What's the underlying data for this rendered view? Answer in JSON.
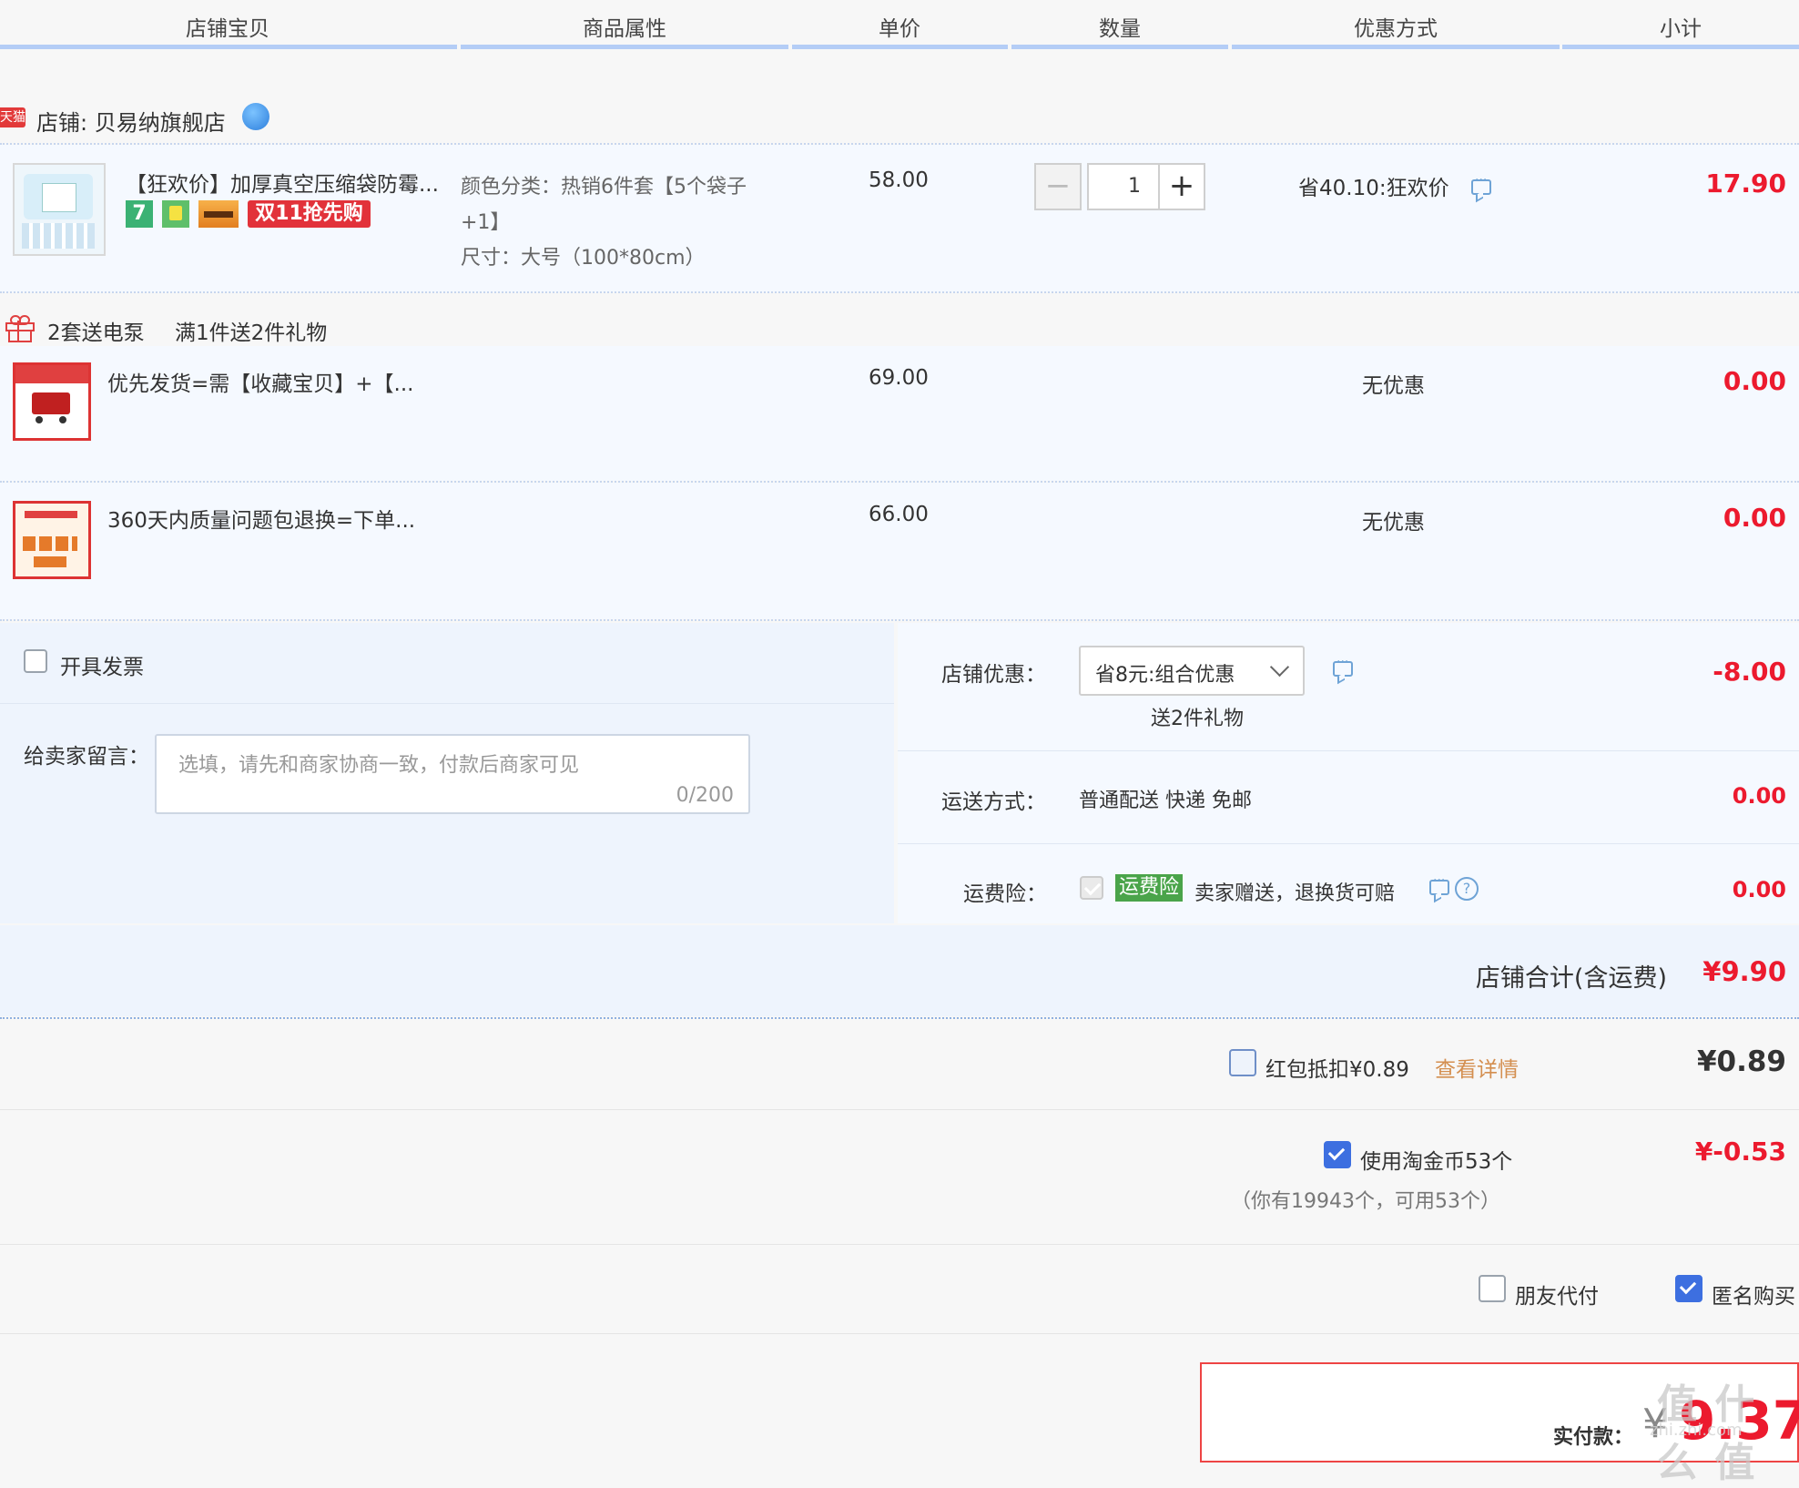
{
  "table_header": {
    "columns": [
      "店铺宝贝",
      "商品属性",
      "单价",
      "数量",
      "优惠方式",
      "小计"
    ]
  },
  "shop": {
    "badge": "天猫",
    "name": "店铺: 贝易纳旗舰店",
    "wangwang_icon": "chat-bubble-icon"
  },
  "main_item": {
    "title": "【狂欢价】加厚真空压缩袋防霉...",
    "badges": [
      "7",
      "保",
      "card",
      "双11抢先购"
    ],
    "attr_color": "颜色分类：热销6件套【5个袋子",
    "attr_color_cont": "+1】",
    "attr_size": "尺寸：大号（100*80cm）",
    "unit_price": "58.00",
    "quantity": "1",
    "discount": "省40.10:狂欢价",
    "subtotal": "17.90"
  },
  "gift_promo": {
    "label1": "2套送电泵",
    "label2": "满1件送2件礼物"
  },
  "gift_items": [
    {
      "title": "优先发货=需【收藏宝贝】+【...",
      "price": "69.00",
      "discount": "无优惠",
      "subtotal": "0.00"
    },
    {
      "title": "360天内质量问题包退换=下单...",
      "price": "66.00",
      "discount": "无优惠",
      "subtotal": "0.00"
    }
  ],
  "options": {
    "invoice_label": "开具发票",
    "message_label": "给卖家留言：",
    "message_placeholder": "选填，请先和商家协商一致，付款后商家可见",
    "message_counter": "0/200",
    "shop_discount_label": "店铺优惠：",
    "shop_discount_value": "省8元:组合优惠",
    "shop_discount_sub": "送2件礼物",
    "shop_discount_amount": "-8.00",
    "shipping_label": "运送方式：",
    "shipping_value": "普通配送 快递 免邮",
    "shipping_amount": "0.00",
    "insurance_label": "运费险：",
    "insurance_badge": "运费险",
    "insurance_text": "卖家赠送，退换货可赔",
    "insurance_amount": "0.00"
  },
  "shop_total": {
    "label": "店铺合计(含运费)",
    "amount": "¥9.90"
  },
  "red_packet": {
    "label": "红包抵扣¥0.89",
    "link": "查看详情",
    "amount": "¥0.89"
  },
  "coins": {
    "label": "使用淘金币53个",
    "sub": "（你有19943个，可用53个）",
    "amount": "¥-0.53"
  },
  "pay_options": {
    "friend_pay": "朋友代付",
    "anonymous": "匿名购买"
  },
  "final": {
    "label": "实付款：",
    "currency": "¥",
    "amount": "9.37",
    "watermark": "值 什么 值",
    "watermark_url": "zhi.zhi.com"
  },
  "colors": {
    "accent_red": "#ec1a2e",
    "header_bar": "#b4cdf6",
    "row_bg": "#f5f9ff",
    "checkbox_blue": "#3d6fe0",
    "insurance_green": "#4aa44a",
    "link_orange": "#d48f50"
  }
}
